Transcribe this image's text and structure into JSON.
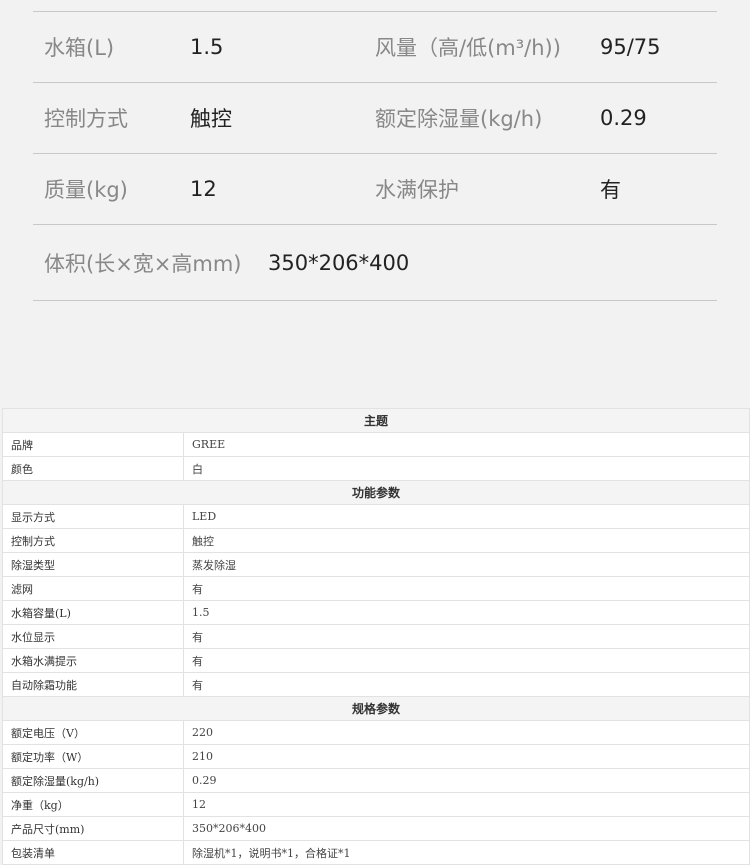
{
  "specs": {
    "rows": [
      [
        {
          "label": "水箱(L)",
          "value": "1.5"
        },
        {
          "label": "风量（高/低(m³/h))",
          "value": "95/75"
        }
      ],
      [
        {
          "label": "控制方式",
          "value": "触控"
        },
        {
          "label": "额定除湿量(kg/h)",
          "value": "0.29"
        }
      ],
      [
        {
          "label": "质量(kg)",
          "value": "12"
        },
        {
          "label": "水满保护",
          "value": "有"
        }
      ]
    ],
    "volume": {
      "label": "体积(长×宽×高mm)",
      "value": "350*206*400"
    }
  },
  "table": {
    "sections": [
      {
        "title": "主题",
        "rows": [
          {
            "k": "品牌",
            "v": "GREE"
          },
          {
            "k": "颜色",
            "v": "白"
          }
        ]
      },
      {
        "title": "功能参数",
        "rows": [
          {
            "k": "显示方式",
            "v": "LED"
          },
          {
            "k": "控制方式",
            "v": "触控"
          },
          {
            "k": "除湿类型",
            "v": "蒸发除湿"
          },
          {
            "k": "滤网",
            "v": "有"
          },
          {
            "k": "水箱容量(L)",
            "v": "1.5"
          },
          {
            "k": "水位显示",
            "v": "有"
          },
          {
            "k": "水箱水满提示",
            "v": "有"
          },
          {
            "k": "自动除霜功能",
            "v": "有"
          }
        ]
      },
      {
        "title": "规格参数",
        "rows": [
          {
            "k": "额定电压（V）",
            "v": "220"
          },
          {
            "k": "额定功率（W）",
            "v": "210"
          },
          {
            "k": "额定除湿量(kg/h)",
            "v": "0.29"
          },
          {
            "k": "净重（kg）",
            "v": "12"
          },
          {
            "k": "产品尺寸(mm)",
            "v": "350*206*400"
          },
          {
            "k": "包装清单",
            "v": "除湿机*1，说明书*1，合格证*1"
          }
        ]
      }
    ]
  }
}
